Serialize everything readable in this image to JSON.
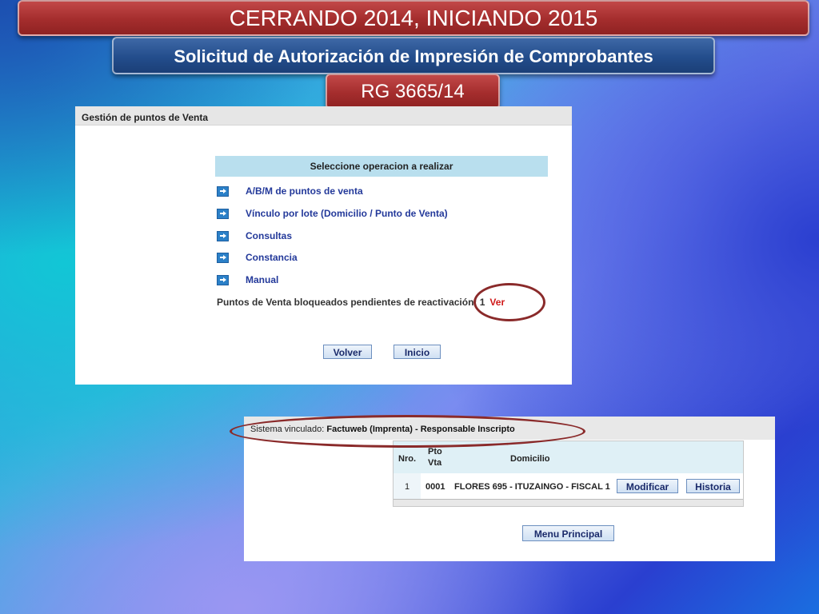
{
  "banners": {
    "title": "CERRANDO 2014, INICIANDO 2015",
    "subtitle": "Solicitud de Autorización de Impresión de Comprobantes",
    "regulation": "RG 3665/14"
  },
  "colors": {
    "banner_red": "#a42d2d",
    "banner_blue": "#234d8c",
    "highlight_circle": "#8a2a2a",
    "link_blue": "#23399a",
    "ver_red": "#d01818"
  },
  "gestion_panel": {
    "header": "Gestión de puntos de Venta",
    "operations_title": "Seleccione operacion a realizar",
    "operations": [
      {
        "label": "A/B/M de puntos de venta",
        "icon": "arrow-right-icon"
      },
      {
        "label": "Vínculo por lote (Domicilio / Punto de Venta)",
        "icon": "arrow-right-icon"
      },
      {
        "label": "Consultas",
        "icon": "arrow-right-icon"
      },
      {
        "label": "Constancia",
        "icon": "arrow-right-icon"
      },
      {
        "label": "Manual",
        "icon": "arrow-right-icon"
      }
    ],
    "blocked_text": "Puntos de Venta bloqueados pendientes de reactivación: 1",
    "ver_link": "Ver",
    "buttons": {
      "volver": "Volver",
      "inicio": "Inicio"
    }
  },
  "sistema_panel": {
    "header_label": "Sistema vinculado:",
    "header_value": "Factuweb (Imprenta) - Responsable Inscripto",
    "table": {
      "columns": [
        "Nro.",
        "Pto Vta",
        "Domicilio"
      ],
      "rows": [
        {
          "nro": "1",
          "pto_vta": "0001",
          "domicilio": "FLORES 695 - ITUZAINGO - FISCAL 1",
          "modificar": "Modificar",
          "historia": "Historia"
        }
      ]
    },
    "menu_button": "Menu Principal"
  }
}
